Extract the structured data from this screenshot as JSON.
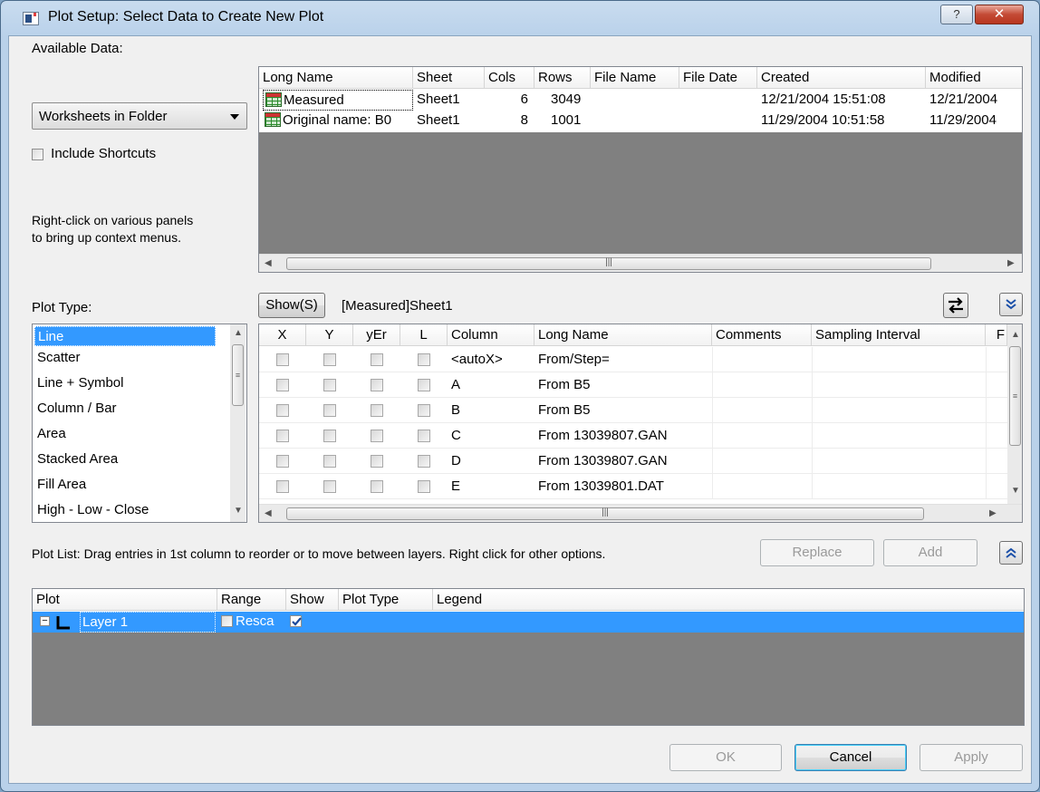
{
  "window": {
    "title": "Plot Setup: Select Data to Create New Plot",
    "help_label": "?",
    "close_label": "✕"
  },
  "left": {
    "available_data_label": "Available Data:",
    "available_data_value": "Worksheets in Folder",
    "include_shortcuts_label": "Include Shortcuts",
    "hint_line1": "Right-click on various panels",
    "hint_line2": "to bring up context menus.",
    "plot_type_label": "Plot Type:"
  },
  "sheets_table": {
    "headers": [
      "Long Name",
      "Sheet",
      "Cols",
      "Rows",
      "File Name",
      "File Date",
      "Created",
      "Modified"
    ],
    "rows": [
      {
        "long_name": "Measured",
        "sheet": "Sheet1",
        "cols": "6",
        "rows": "3049",
        "file_name": "",
        "file_date": "",
        "created": "12/21/2004 15:51:08",
        "modified": "12/21/2004"
      },
      {
        "long_name": "Original name: B0",
        "sheet": "Sheet1",
        "cols": "8",
        "rows": "1001",
        "file_name": "",
        "file_date": "",
        "created": "11/29/2004 10:51:58",
        "modified": "11/29/2004"
      }
    ]
  },
  "plot_types": [
    "Line",
    "Scatter",
    "Line + Symbol",
    "Column / Bar",
    "Area",
    "Stacked Area",
    "Fill Area",
    "High - Low - Close"
  ],
  "columns_panel": {
    "show_button": "Show(S)",
    "current_sheet": "[Measured]Sheet1",
    "headers": [
      "X",
      "Y",
      "yEr",
      "L",
      "Column",
      "Long Name",
      "Comments",
      "Sampling Interval",
      "F"
    ],
    "rows": [
      {
        "column": "<autoX>",
        "long_name": "From/Step="
      },
      {
        "column": "A",
        "long_name": "From B5"
      },
      {
        "column": "B",
        "long_name": "From B5"
      },
      {
        "column": "C",
        "long_name": "From 13039807.GAN"
      },
      {
        "column": "D",
        "long_name": "From 13039807.GAN"
      },
      {
        "column": "E",
        "long_name": "From 13039801.DAT"
      }
    ]
  },
  "plot_list": {
    "instructions": "Plot List: Drag entries in 1st column to reorder or to move between layers. Right click for other options.",
    "replace_label": "Replace",
    "add_label": "Add",
    "headers": [
      "Plot",
      "Range",
      "Show",
      "Plot Type",
      "Legend"
    ],
    "layer_label": "Layer 1",
    "range_value": "Resca"
  },
  "footer": {
    "ok_label": "OK",
    "cancel_label": "Cancel",
    "apply_label": "Apply"
  }
}
